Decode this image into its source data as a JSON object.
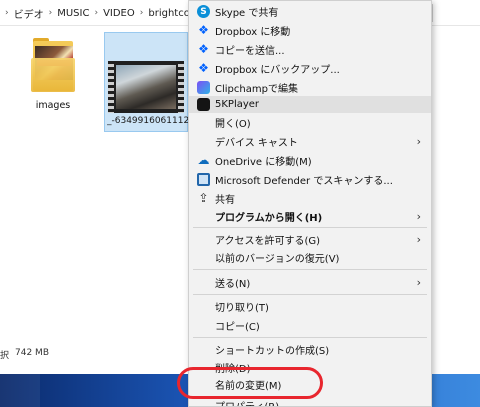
{
  "breadcrumb": {
    "items": [
      "ビデオ",
      "MUSIC",
      "VIDEO",
      "brightco"
    ],
    "separator": "›"
  },
  "files": [
    {
      "name": "images",
      "type": "folder"
    },
    {
      "name": "_-6349916061112",
      "type": "video",
      "selected": true
    }
  ],
  "status": {
    "selected_suffix": "択",
    "size": "742 MB"
  },
  "context_menu": {
    "items": [
      {
        "label": "Skype で共有",
        "icon": "skype-icon"
      },
      {
        "label": "Dropbox に移動",
        "icon": "dropbox-icon"
      },
      {
        "label": "コピーを送信...",
        "icon": "dropbox-icon"
      },
      {
        "label": "Dropbox にバックアップ...",
        "icon": "dropbox-icon"
      },
      {
        "label": "Clipchampで編集",
        "icon": "clipchamp-icon"
      },
      {
        "label": "5KPlayer",
        "icon": "5kplayer-icon",
        "highlighted": true
      },
      {
        "label": "開く(O)"
      },
      {
        "label": "デバイス キャスト",
        "submenu": true
      },
      {
        "label": "OneDrive に移動(M)",
        "icon": "onedrive-icon"
      },
      {
        "label": "Microsoft Defender でスキャンする...",
        "icon": "defender-icon"
      },
      {
        "label": "共有",
        "icon": "share-icon"
      },
      {
        "label": "プログラムから開く(H)",
        "submenu": true,
        "bold": true
      },
      {
        "label": "アクセスを許可する(G)",
        "submenu": true
      },
      {
        "label": "以前のバージョンの復元(V)"
      },
      {
        "label": "送る(N)",
        "submenu": true
      },
      {
        "label": "切り取り(T)"
      },
      {
        "label": "コピー(C)"
      },
      {
        "label": "ショートカットの作成(S)"
      },
      {
        "label": "削除(D)"
      },
      {
        "label": "名前の変更(M)",
        "circled": true
      },
      {
        "label": "プロパティ(R)"
      }
    ],
    "submenu_arrow": "›"
  },
  "colors": {
    "highlight_ring": "#e8262e",
    "selection": "#cce4f7",
    "taskbar": "#1d5bbf"
  }
}
